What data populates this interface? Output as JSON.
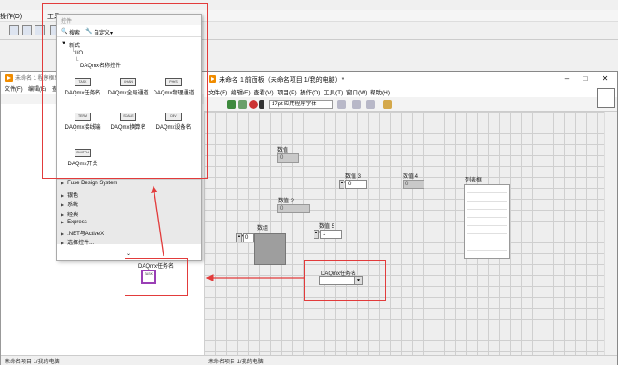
{
  "main_menu": [
    "操作(O)",
    "工具"
  ],
  "bd_window": {
    "title": "未命名 1 程序框图",
    "menu": [
      "文件(F)",
      "编辑(E)",
      "查看"
    ],
    "status": "未命名项目 1/我的电脑"
  },
  "fp_window": {
    "title": "未命名 1 前面板（未命名项目 1/我的电脑）*",
    "menu": [
      "文件(F)",
      "编辑(E)",
      "查看(V)",
      "项目(P)",
      "操作(O)",
      "工具(T)",
      "窗口(W)",
      "帮助(H)"
    ],
    "font": "17pt 应用程序字体",
    "status": "未命名项目 1/我的电脑"
  },
  "front_panel": {
    "numeric_indicators": [
      {
        "label": "数值",
        "value": "0"
      },
      {
        "label": "数值 2",
        "value": "0"
      },
      {
        "label": "数值 4",
        "value": "0"
      }
    ],
    "numeric_controls": [
      {
        "label": "数值 3",
        "value": "0"
      },
      {
        "label": "数值 5",
        "value": "1"
      }
    ],
    "array": {
      "label": "数组",
      "index": "0"
    },
    "listbox": {
      "label": "列表框"
    },
    "daq_task": {
      "label": "DAQmx任务名"
    }
  },
  "palette": {
    "title": "控件",
    "search": "搜索",
    "customize": "自定义▾",
    "tree": [
      "新式",
      "I/O",
      "DAQmx名称控件"
    ],
    "items": [
      {
        "icon": "TASK",
        "label": "DAQmx任务名"
      },
      {
        "icon": "CHAN",
        "label": "DAQmx全局通道"
      },
      {
        "icon": "PHYS",
        "label": "DAQmx物理通道"
      },
      {
        "icon": "TERM",
        "label": "DAQmx接线端"
      },
      {
        "icon": "SCALE",
        "label": "DAQmx换算名"
      },
      {
        "icon": "DEV",
        "label": "DAQmx设备名"
      },
      {
        "icon": "SWITCH",
        "label": "DAQmx开关"
      }
    ],
    "categories": [
      "Fuse Design System",
      "银色",
      "系统",
      "经典",
      "Express",
      ".NET与ActiveX",
      "选择控件..."
    ],
    "more": "⌄"
  },
  "bd_terminal": {
    "label": "DAQmx任务名",
    "icon": "TASK"
  },
  "colors": {
    "annotation": "#e23b3b",
    "terminal_border": "#9a3fb5",
    "labview_orange": "#f08c00"
  }
}
